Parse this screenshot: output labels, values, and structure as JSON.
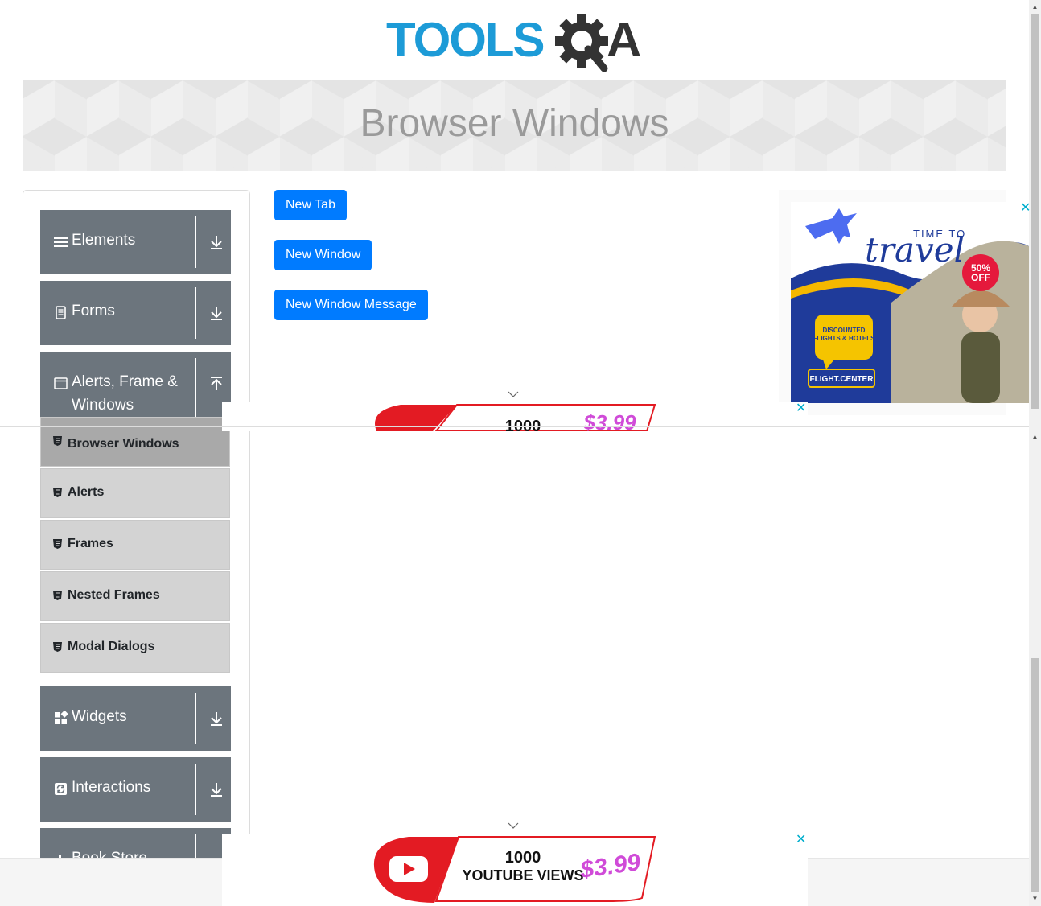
{
  "brand": {
    "logo_text_blue": "TOOLS",
    "logo_text_dark": "A"
  },
  "banner": {
    "title": "Browser Windows"
  },
  "sidebar": {
    "groups": [
      {
        "label": "Elements",
        "icon": "hamburger-icon"
      },
      {
        "label": "Forms",
        "icon": "document-icon"
      },
      {
        "label_line1": "Alerts, Frame &",
        "label_line2": "Windows",
        "icon": "window-icon"
      },
      {
        "label": "Widgets",
        "icon": "widgets-icon"
      },
      {
        "label": "Interactions",
        "icon": "interactions-icon"
      },
      {
        "label": "Book Store",
        "icon": "book-store-icon"
      }
    ],
    "items": [
      {
        "label": "Browser Windows",
        "active": true
      },
      {
        "label": "Alerts"
      },
      {
        "label": "Frames"
      },
      {
        "label": "Nested Frames"
      },
      {
        "label": "Modal Dialogs"
      }
    ]
  },
  "main": {
    "buttons": [
      {
        "label": "New Tab"
      },
      {
        "label": "New Window"
      },
      {
        "label": "New Window Message"
      }
    ]
  },
  "ads": {
    "travel": {
      "line1": "TIME TO",
      "line2": "travel",
      "discount": "50%",
      "discount_sub": "OFF",
      "badge_line1": "DISCOUNTED",
      "badge_line2": "FLIGHTS & HOTELS",
      "brand": "FLIGHT.CENTER"
    },
    "youtube": {
      "line1": "1000",
      "line2": "YOUTUBE VIEWS",
      "price": "$3.99"
    },
    "close_glyph": "✕"
  },
  "colors": {
    "primary": "#007bff",
    "group_bg": "#6c757d",
    "item_bg": "#d3d3d3",
    "item_active_bg": "#a9a9a9",
    "logo_blue": "#1d9bd7",
    "ad_close": "#00aecd"
  }
}
